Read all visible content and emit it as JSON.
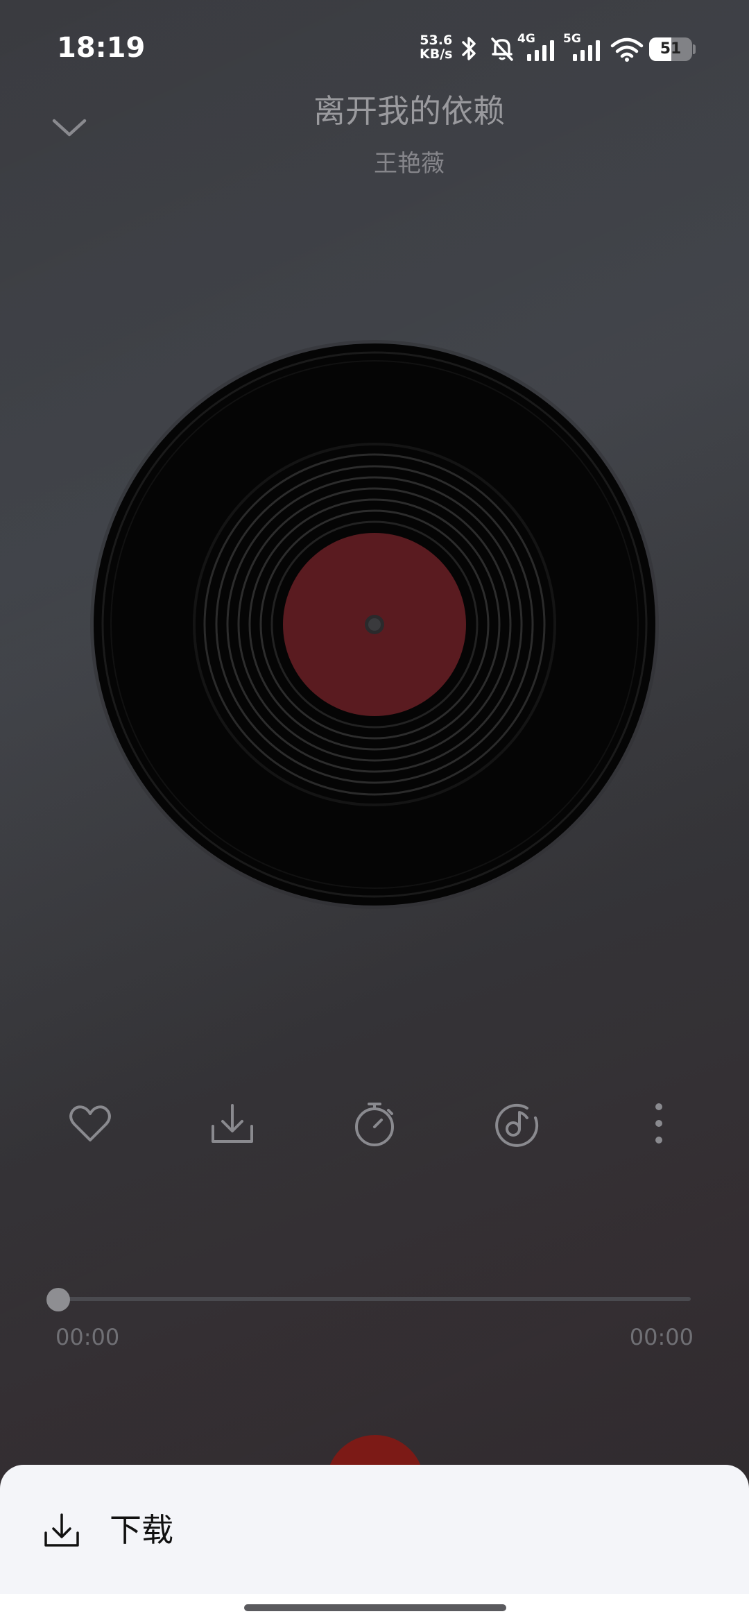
{
  "status_bar": {
    "time": "18:19",
    "net_speed_value": "53.6",
    "net_speed_unit": "KB/s",
    "net_4g": "4G",
    "net_5g": "5G",
    "battery": "51",
    "battery_level": 0.51,
    "icons": [
      "bluetooth-icon",
      "mute-bell-icon",
      "signal-4g-icon",
      "signal-5g-icon",
      "wifi-icon",
      "battery-icon"
    ]
  },
  "header": {
    "title": "离开我的依赖",
    "artist": "王艳薇"
  },
  "actions": [
    "heart-icon",
    "download-icon",
    "timer-icon",
    "music-note-icon",
    "more-vertical-icon"
  ],
  "player": {
    "current_time": "00:00",
    "total_time": "00:00",
    "progress": 0
  },
  "sheet": {
    "download_label": "下载"
  },
  "colors": {
    "label_red": "#5a1b20",
    "play_red": "#7c1a16",
    "sheet_bg": "#f4f5f9"
  }
}
